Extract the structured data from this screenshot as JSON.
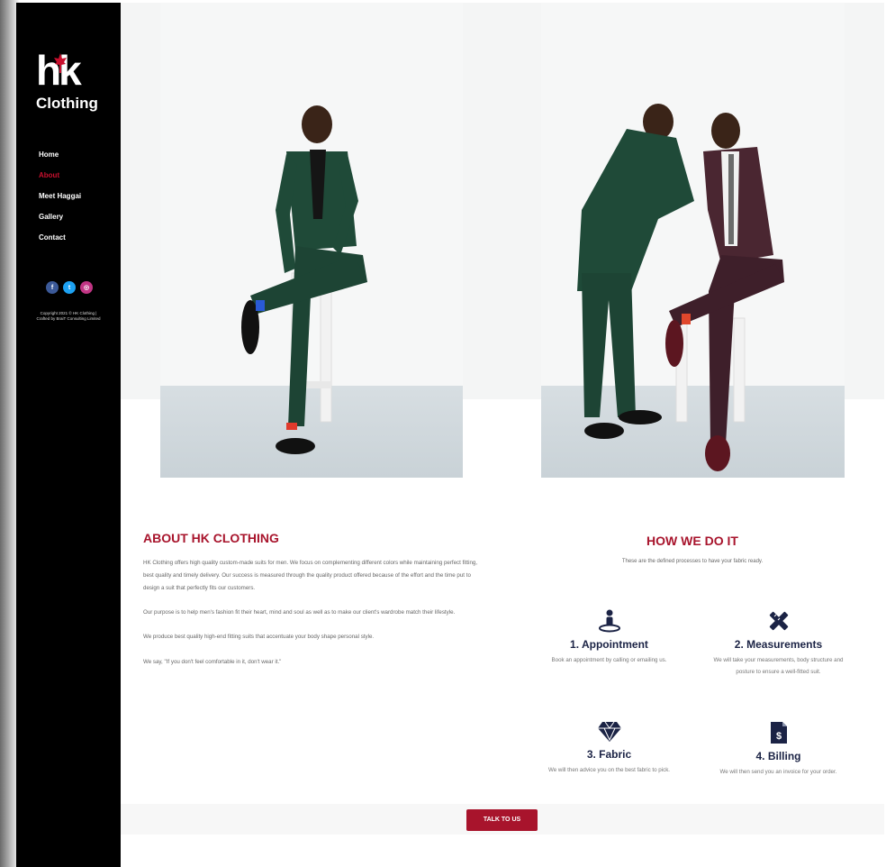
{
  "brand": {
    "logo_mark": "hk",
    "logo_word": "Clothing",
    "accent_color": "#a8142c"
  },
  "sidebar": {
    "nav": [
      {
        "label": "Home"
      },
      {
        "label": "About",
        "active": true
      },
      {
        "label": "Meet Haggai"
      },
      {
        "label": "Gallery"
      },
      {
        "label": "Contact"
      }
    ],
    "socials": [
      {
        "icon": "facebook-icon",
        "glyph": "f"
      },
      {
        "icon": "twitter-icon",
        "glyph": "t"
      },
      {
        "icon": "instagram-icon",
        "glyph": "◎"
      }
    ],
    "copyright_line1": "Copyright 2021 © HK Clothing |",
    "copyright_line2": "Crafted by BraiT Consulting Limited"
  },
  "about": {
    "title": "ABOUT HK CLOTHING",
    "paragraphs": [
      "HK Clothing offers high quality custom-made suits for men. We focus on complementing different colors while maintaining perfect fitting, best quality and timely delivery. Our success is measured through the quality product offered because of the effort and the time put to design a suit that perfectly fits our customers.",
      "Our purpose is to help men's fashion fit their heart, mind and soul as well as to make our client's wardrobe match their lifestyle.",
      "We produce best quality high-end fitting suits that accentuate your body shape personal style.",
      "We say, \"If you don't feel comfortable in it, don't wear it.\""
    ]
  },
  "how": {
    "title": "HOW WE DO IT",
    "subtitle": "These are the defined processes to have your fabric ready.",
    "steps": [
      {
        "icon": "appointment-person-icon",
        "title": "1. Appointment",
        "desc": "Book an appointment by calling or emailing us."
      },
      {
        "icon": "measuring-tools-icon",
        "title": "2. Measurements",
        "desc": "We will take your measurements, body structure and posture to ensure a well-fitted suit."
      },
      {
        "icon": "diamond-icon",
        "title": "3. Fabric",
        "desc": "We will then advice you on the best fabric to pick."
      },
      {
        "icon": "invoice-icon",
        "title": "4. Billing",
        "desc": "We will then send you an invoice for your order."
      }
    ]
  },
  "cta": {
    "label": "TALK TO US"
  }
}
